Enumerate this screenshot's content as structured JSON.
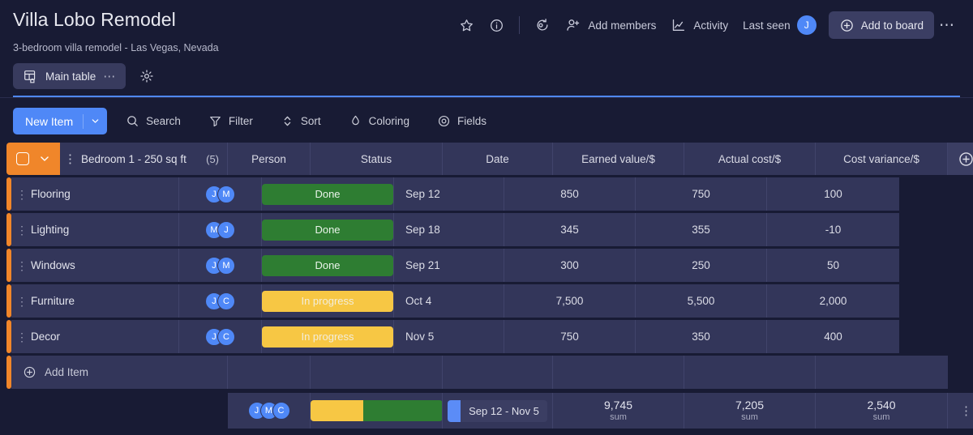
{
  "board": {
    "title": "Villa Lobo Remodel",
    "subtitle": "3-bedroom villa remodel - Las Vegas, Nevada",
    "header_actions": {
      "add_members": "Add members",
      "activity": "Activity",
      "last_seen": "Last seen",
      "last_seen_avatar": "J",
      "add_to_board": "Add to board"
    },
    "view_tab": {
      "label": "Main table",
      "dots": "⋯"
    }
  },
  "action_bar": {
    "new_item": "New Item",
    "search": "Search",
    "filter": "Filter",
    "sort": "Sort",
    "coloring": "Coloring",
    "fields": "Fields"
  },
  "table": {
    "group_name": "Bedroom 1 - 250 sq ft",
    "group_count": "(5)",
    "columns": [
      "Person",
      "Status",
      "Date",
      "Earned value/$",
      "Actual cost/$",
      "Cost variance/$"
    ],
    "rows": [
      {
        "name": "Flooring",
        "people": [
          "J",
          "M"
        ],
        "status": "Done",
        "status_kind": "done",
        "date": "Sep 12",
        "earned": "850",
        "actual": "750",
        "variance": "100"
      },
      {
        "name": "Lighting",
        "people": [
          "M",
          "J"
        ],
        "status": "Done",
        "status_kind": "done",
        "date": "Sep 18",
        "earned": "345",
        "actual": "355",
        "variance": "-10"
      },
      {
        "name": "Windows",
        "people": [
          "J",
          "M"
        ],
        "status": "Done",
        "status_kind": "done",
        "date": "Sep 21",
        "earned": "300",
        "actual": "250",
        "variance": "50"
      },
      {
        "name": "Furniture",
        "people": [
          "J",
          "C"
        ],
        "status": "In progress",
        "status_kind": "progress",
        "date": "Oct 4",
        "earned": "7,500",
        "actual": "5,500",
        "variance": "2,000"
      },
      {
        "name": "Decor",
        "people": [
          "J",
          "C"
        ],
        "status": "In progress",
        "status_kind": "progress",
        "date": "Nov 5",
        "earned": "750",
        "actual": "350",
        "variance": "400"
      }
    ],
    "add_item_label": "Add Item",
    "summary": {
      "people": [
        "J",
        "M",
        "C"
      ],
      "status_progress_pct": 40,
      "status_done_pct": 60,
      "date_range": "Sep 12 - Nov 5",
      "earned": "9,745",
      "actual": "7,205",
      "variance": "2,540",
      "sum_label": "sum"
    }
  },
  "colors": {
    "group_accent": "#f0862a",
    "primary": "#4f88f7",
    "status_done": "#2e7d32",
    "status_progress": "#f7c744",
    "bg": "#181b34",
    "cell": "#33365a"
  }
}
